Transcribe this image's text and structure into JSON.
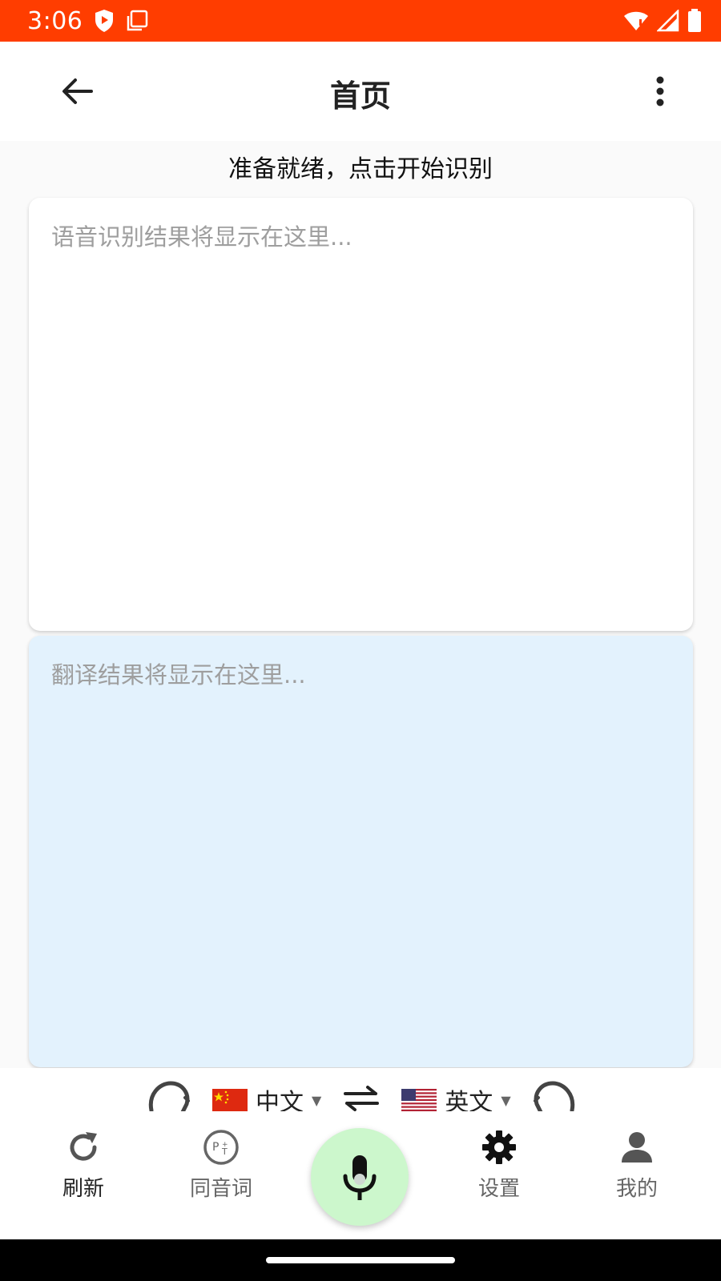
{
  "status_bar": {
    "time": "3:06",
    "icons": [
      "shield-icon",
      "screen-copy-icon",
      "wifi-icon",
      "signal-icon",
      "battery-icon"
    ]
  },
  "app_bar": {
    "title": "首页",
    "back_icon": "arrow-back-icon",
    "more_icon": "more-vert-icon"
  },
  "status_text": "准备就绪，点击开始识别",
  "recognition": {
    "placeholder": "语音识别结果将显示在这里..."
  },
  "translation": {
    "placeholder": "翻译结果将显示在这里..."
  },
  "language_bar": {
    "source": {
      "label": "中文",
      "flag": "china-flag-icon"
    },
    "target": {
      "label": "英文",
      "flag": "usa-flag-icon"
    },
    "swap_icon": "swap-arrows-icon",
    "left_icon": "voice-left-icon",
    "right_icon": "voice-right-icon"
  },
  "bottom_nav": {
    "items": [
      {
        "label": "刷新",
        "icon": "refresh-icon"
      },
      {
        "label": "同音词",
        "icon": "pinyin-icon"
      },
      {
        "label": "",
        "icon": "mic-icon"
      },
      {
        "label": "设置",
        "icon": "gear-icon"
      },
      {
        "label": "我的",
        "icon": "person-icon"
      }
    ]
  },
  "colors": {
    "status_bar": "#ff3d00",
    "translation_card": "#e3f2fd",
    "mic_button": "#ccf7cc"
  }
}
